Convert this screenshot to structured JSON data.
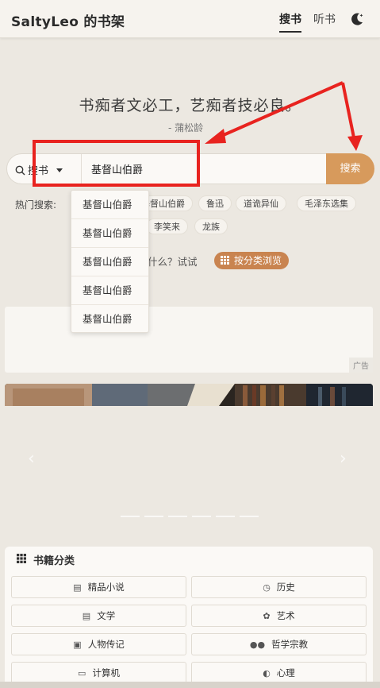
{
  "brand": "SaltyLeo 的书架",
  "nav": {
    "search_books": "搜书",
    "listen_books": "听书"
  },
  "quote": {
    "text": "书痴者文必工，艺痴者技必良。",
    "author": "- 蒲松龄"
  },
  "search": {
    "type_label": "搜书",
    "value": "基督山伯爵",
    "button": "搜索"
  },
  "hot": {
    "label": "热门搜索:",
    "tags": [
      "基督山伯爵",
      "鲁迅",
      "道诡异仙",
      "毛泽东选集",
      "李笑来",
      "龙族"
    ]
  },
  "hint": {
    "text": "什么？试试",
    "button": "按分类浏览"
  },
  "dropdown": [
    "基督山伯爵",
    "基督山伯爵",
    "基督山伯爵",
    "基督山伯爵",
    "基督山伯爵"
  ],
  "ad": {
    "tag": "广告"
  },
  "categories": {
    "title": "书籍分类",
    "items": [
      {
        "label": "精品小说",
        "icon": "book-open-icon"
      },
      {
        "label": "历史",
        "icon": "clock-icon"
      },
      {
        "label": "文学",
        "icon": "book-icon"
      },
      {
        "label": "艺术",
        "icon": "palette-icon"
      },
      {
        "label": "人物传记",
        "icon": "person-card-icon"
      },
      {
        "label": "哲学宗教",
        "icon": "people-icon"
      },
      {
        "label": "计算机",
        "icon": "laptop-icon"
      },
      {
        "label": "心理",
        "icon": "shield-icon"
      }
    ]
  },
  "colors": {
    "accent": "#d79a5c",
    "annotation": "#e8231f",
    "background": "#ece8e1"
  }
}
